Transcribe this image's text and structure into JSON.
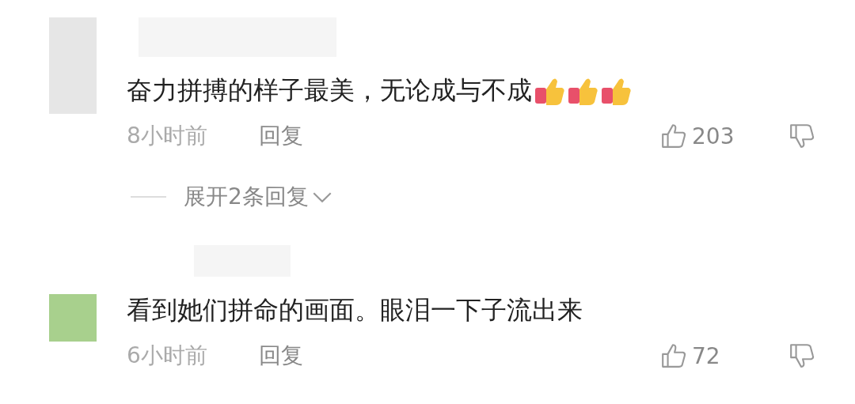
{
  "comments": [
    {
      "avatar": {
        "color": "#e6e6e6"
      },
      "text": "奋力拼搏的样子最美，无论成与不成",
      "emojis": [
        {
          "kind": "thumbs-up"
        },
        {
          "kind": "thumbs-up"
        },
        {
          "kind": "thumbs-up"
        }
      ],
      "time": "8小时前",
      "reply": "回复",
      "likes": "203",
      "expand": "展开2条回复"
    },
    {
      "avatar": {
        "color": "#a8d08d"
      },
      "text": "看到她们拼命的画面。眼泪一下子流出来",
      "time": "6小时前",
      "reply": "回复",
      "likes": "72"
    }
  ]
}
